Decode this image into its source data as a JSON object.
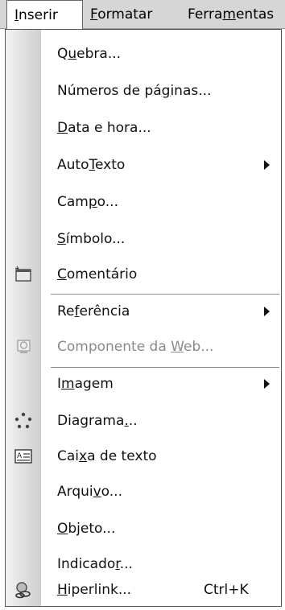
{
  "menubar": {
    "items": [
      {
        "pre": "",
        "u": "I",
        "post": "nserir"
      },
      {
        "pre": "",
        "u": "F",
        "post": "ormatar"
      },
      {
        "pre": "Ferra",
        "u": "m",
        "post": "entas"
      }
    ]
  },
  "menu": {
    "items": [
      {
        "pre": "Q",
        "u": "u",
        "post": "ebra..."
      },
      {
        "pre": "Números de pá",
        "u": "g",
        "post": "inas..."
      },
      {
        "pre": "",
        "u": "D",
        "post": "ata e hora..."
      },
      {
        "pre": "Auto",
        "u": "T",
        "post": "exto"
      },
      {
        "pre": "Cam",
        "u": "p",
        "post": "o..."
      },
      {
        "pre": "",
        "u": "S",
        "post": "ímbolo..."
      },
      {
        "pre": "",
        "u": "C",
        "post": "omentário"
      },
      {
        "pre": "Re",
        "u": "f",
        "post": "erência"
      },
      {
        "pre": "Componente da ",
        "u": "W",
        "post": "eb..."
      },
      {
        "pre": "I",
        "u": "m",
        "post": "agem"
      },
      {
        "pre": "Diagrama",
        "u": ".",
        "post": ".."
      },
      {
        "pre": "Cai",
        "u": "x",
        "post": "a de texto"
      },
      {
        "pre": "Arqui",
        "u": "v",
        "post": "o..."
      },
      {
        "pre": "",
        "u": "O",
        "post": "bjeto..."
      },
      {
        "pre": "Indicado",
        "u": "r",
        "post": "..."
      },
      {
        "pre": "",
        "u": "H",
        "post": "iperlink...",
        "shortcut": "Ctrl+K"
      }
    ]
  },
  "icons": {
    "comment": "comment-icon",
    "web_component": "web-component-icon",
    "diagram": "diagram-icon",
    "text_box": "text-box-icon",
    "hyperlink": "hyperlink-icon",
    "submenu": "submenu-arrow-icon"
  },
  "colors": {
    "menubar_bg": "#d6d6d6",
    "disabled_text": "#8a8a8a",
    "gutter_start": "#f2f2f2",
    "gutter_end": "#cfcfcf"
  }
}
